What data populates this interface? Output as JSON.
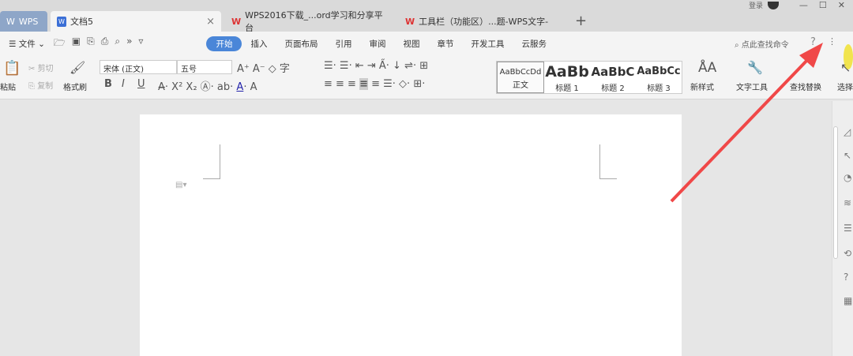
{
  "titlebar": {
    "tabs": [
      {
        "label": "WPS"
      },
      {
        "label": "文档5",
        "close": "×"
      },
      {
        "label": "WPS2016下载_...ord学习和分享平台"
      },
      {
        "label": "工具栏（功能区）...题-WPS文字-"
      }
    ],
    "new_tab": "+",
    "user": "登录",
    "controls": [
      "—",
      "☐",
      "✕"
    ]
  },
  "menu": {
    "file": "☰ 文件 ⌄",
    "items": [
      "开始",
      "插入",
      "页面布局",
      "引用",
      "审阅",
      "视图",
      "章节",
      "开发工具",
      "云服务"
    ],
    "active": "开始",
    "search_placeholder": "点此查找命令",
    "help": "?",
    "more": "⋮"
  },
  "ribbon": {
    "paste": "粘贴",
    "cut": "剪切",
    "copy": "复制",
    "format_painter": "格式刷",
    "font": "宋体 (正文)",
    "size": "五号",
    "bold": "B",
    "italic": "I",
    "underline": "U",
    "styles": [
      {
        "preview": "AaBbCcDd",
        "label": "正文"
      },
      {
        "preview": "AaBb",
        "label": "标题 1"
      },
      {
        "preview": "AaBbC",
        "label": "标题 2"
      },
      {
        "preview": "AaBbCc",
        "label": "标题 3"
      }
    ],
    "new_style": "新样式",
    "text_tools": "文字工具",
    "find_replace": "查找替换",
    "select": "选择"
  },
  "colors": {
    "accent": "#4a86d8",
    "arrow": "#f04848"
  }
}
